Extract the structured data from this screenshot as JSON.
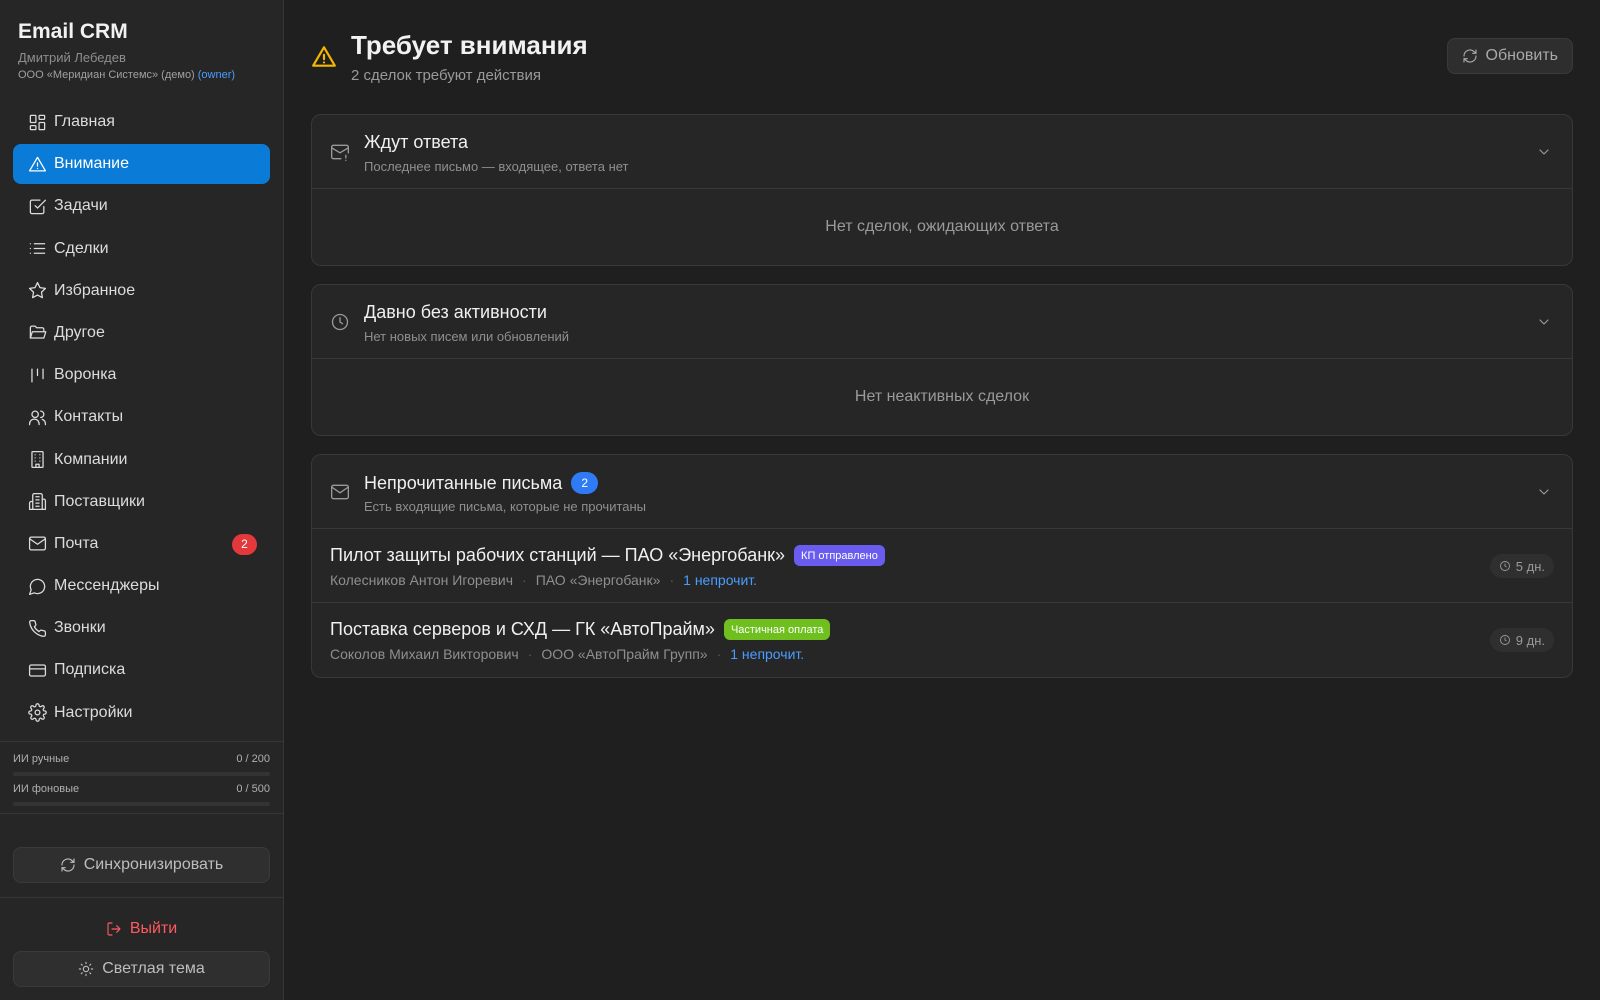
{
  "brand": {
    "title": "Email CRM",
    "user": "Дмитрий Лебедев",
    "org": "ООО «Меридиан Системс» (демо)",
    "role": "(owner)"
  },
  "nav": {
    "items": [
      {
        "label": "Главная",
        "icon": "grid-icon"
      },
      {
        "label": "Внимание",
        "icon": "warning-icon",
        "active": true
      },
      {
        "label": "Задачи",
        "icon": "checkbox-icon"
      },
      {
        "label": "Сделки",
        "icon": "list-icon"
      },
      {
        "label": "Избранное",
        "icon": "star-icon"
      },
      {
        "label": "Другое",
        "icon": "folder-icon"
      },
      {
        "label": "Воронка",
        "icon": "kanban-icon"
      },
      {
        "label": "Контакты",
        "icon": "users-icon"
      },
      {
        "label": "Компании",
        "icon": "building-icon"
      },
      {
        "label": "Поставщики",
        "icon": "factory-icon"
      },
      {
        "label": "Почта",
        "icon": "mail-icon",
        "badge": "2"
      },
      {
        "label": "Мессенджеры",
        "icon": "chat-icon"
      },
      {
        "label": "Звонки",
        "icon": "phone-icon"
      },
      {
        "label": "Подписка",
        "icon": "card-icon"
      },
      {
        "label": "Настройки",
        "icon": "gear-icon"
      }
    ]
  },
  "quotas": [
    {
      "label": "ИИ ручные",
      "value": "0 / 200",
      "fraction": 0
    },
    {
      "label": "ИИ фоновые",
      "value": "0 / 500",
      "fraction": 0
    }
  ],
  "actions": {
    "sync": "Синхронизировать",
    "logout": "Выйти",
    "theme": "Светлая тема"
  },
  "header": {
    "title": "Требует внимания",
    "subtitle": "2 сделок требуют действия",
    "refresh": "Обновить"
  },
  "sections": {
    "awaiting": {
      "title": "Ждут ответа",
      "desc": "Последнее письмо — входящее, ответа нет",
      "empty": "Нет сделок, ожидающих ответа"
    },
    "inactive": {
      "title": "Давно без активности",
      "desc": "Нет новых писем или обновлений",
      "empty": "Нет неактивных сделок"
    },
    "unread": {
      "title": "Непрочитанные письма",
      "count": "2",
      "desc": "Есть входящие письма, которые не прочитаны",
      "deals": [
        {
          "title": "Пилот защиты рабочих станций — ПАО «Энергобанк»",
          "tag": "КП отправлено",
          "tag_color": "#6b5cf0",
          "contact": "Колесников Антон Игоревич",
          "company": "ПАО «Энергобанк»",
          "unread": "1 непрочит.",
          "age": "5 дн."
        },
        {
          "title": "Поставка серверов и СХД — ГК «АвтоПрайм»",
          "tag": "Частичная оплата",
          "tag_color": "#6fbf1f",
          "contact": "Соколов Михаил Викторович",
          "company": "ООО «АвтоПрайм Групп»",
          "unread": "1 непрочит.",
          "age": "9 дн."
        }
      ]
    }
  },
  "colors": {
    "accent": "#0a7bd6",
    "danger": "#e5383b",
    "warning": "#f5b800",
    "link": "#4a9dff"
  }
}
